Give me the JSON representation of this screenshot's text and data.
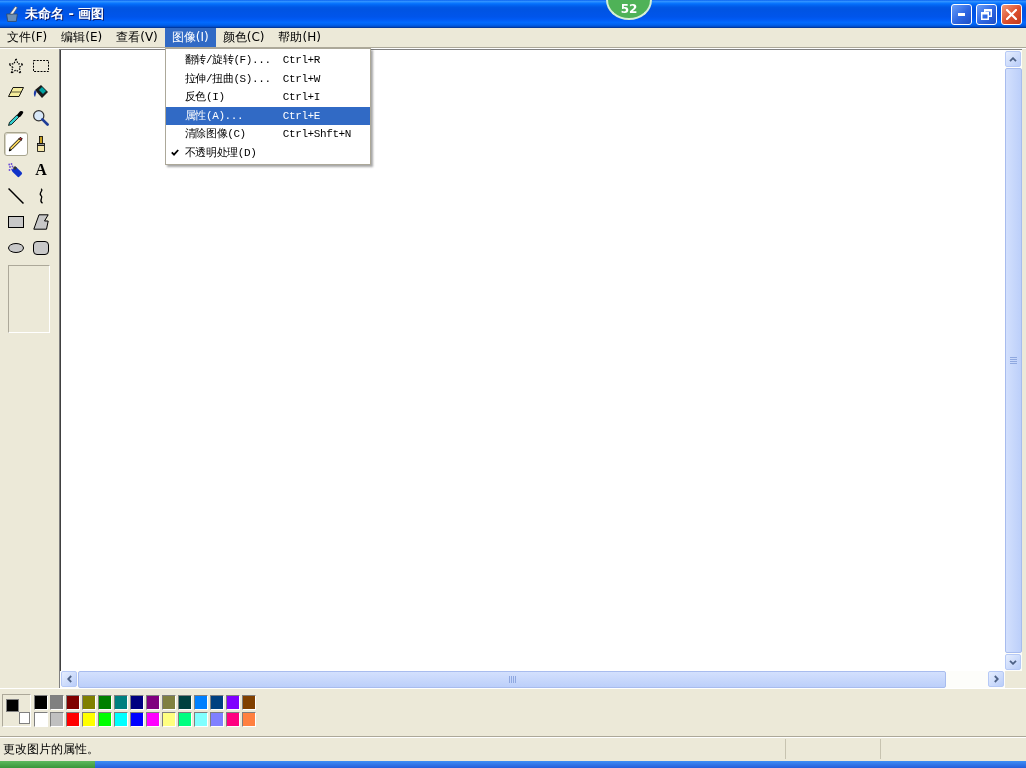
{
  "window": {
    "title": "未命名 - 画图"
  },
  "floating_badge": {
    "text": "52"
  },
  "menu_bar": [
    {
      "label": "文件(F)",
      "selected": false
    },
    {
      "label": "编辑(E)",
      "selected": false
    },
    {
      "label": "查看(V)",
      "selected": false
    },
    {
      "label": "图像(I)",
      "selected": true
    },
    {
      "label": "颜色(C)",
      "selected": false
    },
    {
      "label": "帮助(H)",
      "selected": false
    }
  ],
  "open_menu": {
    "items": [
      {
        "label": "翻转/旋转(F)...",
        "shortcut": "Ctrl+R",
        "selected": false,
        "checked": false
      },
      {
        "label": "拉伸/扭曲(S)...",
        "shortcut": "Ctrl+W",
        "selected": false,
        "checked": false
      },
      {
        "label": "反色(I)",
        "shortcut": "Ctrl+I",
        "selected": false,
        "checked": false
      },
      {
        "label": "属性(A)...",
        "shortcut": "Ctrl+E",
        "selected": true,
        "checked": false
      },
      {
        "label": "清除图像(C)",
        "shortcut": "Ctrl+Shft+N",
        "selected": false,
        "checked": false
      },
      {
        "label": "不透明处理(D)",
        "selected": false,
        "checked": true
      }
    ]
  },
  "toolbox": {
    "tools": [
      {
        "kind": "free_select",
        "selected": false
      },
      {
        "kind": "rect_select",
        "selected": false
      },
      {
        "kind": "eraser",
        "selected": false
      },
      {
        "kind": "fill",
        "selected": false
      },
      {
        "kind": "picker",
        "selected": false
      },
      {
        "kind": "magnifier",
        "selected": false
      },
      {
        "kind": "pencil",
        "selected": true
      },
      {
        "kind": "brush",
        "selected": false
      },
      {
        "kind": "airbrush",
        "selected": false
      },
      {
        "kind": "text",
        "label": "A",
        "selected": false
      },
      {
        "kind": "line",
        "selected": false
      },
      {
        "kind": "curve",
        "selected": false
      },
      {
        "kind": "rectangle",
        "selected": false
      },
      {
        "kind": "polygon",
        "selected": false
      },
      {
        "kind": "ellipse",
        "selected": false
      },
      {
        "kind": "rounded_rectangle",
        "selected": false
      }
    ]
  },
  "palette": {
    "foreground": {
      "color": "#000000"
    },
    "background": {
      "color": "#ffffff"
    },
    "colors": [
      {
        "color": "#000000"
      },
      {
        "color": "#808080"
      },
      {
        "color": "#800000"
      },
      {
        "color": "#808000"
      },
      {
        "color": "#008000"
      },
      {
        "color": "#008080"
      },
      {
        "color": "#000080"
      },
      {
        "color": "#800080"
      },
      {
        "color": "#808040"
      },
      {
        "color": "#004040"
      },
      {
        "color": "#0080ff"
      },
      {
        "color": "#004080"
      },
      {
        "color": "#8000ff"
      },
      {
        "color": "#804000"
      },
      {
        "color": "#ffffff"
      },
      {
        "color": "#c0c0c0"
      },
      {
        "color": "#ff0000"
      },
      {
        "color": "#ffff00"
      },
      {
        "color": "#00ff00"
      },
      {
        "color": "#00ffff"
      },
      {
        "color": "#0000ff"
      },
      {
        "color": "#ff00ff"
      },
      {
        "color": "#ffff80"
      },
      {
        "color": "#00ff80"
      },
      {
        "color": "#80ffff"
      },
      {
        "color": "#8080ff"
      },
      {
        "color": "#ff0080"
      },
      {
        "color": "#ff8040"
      }
    ]
  },
  "status_bar": {
    "text": "更改图片的属性。"
  }
}
